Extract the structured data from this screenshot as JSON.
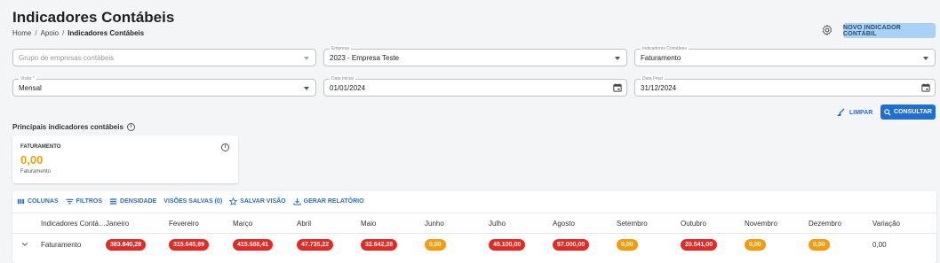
{
  "page": {
    "title": "Indicadores Contábeis",
    "breadcrumb": [
      "Home",
      "Apoio",
      "Indicadores Contábeis"
    ],
    "breadcrumb_sep": "/",
    "new_button": "NOVO INDICADOR CONTÁBIL"
  },
  "filters": {
    "grupo": {
      "placeholder": "Grupo de empresas contábeis"
    },
    "empresa": {
      "legend": "Empresa",
      "value": "2023 - Empresa Teste"
    },
    "indicadores": {
      "legend": "Indicadores Contábeis",
      "value": "Faturamento"
    },
    "visao": {
      "legend": "Visão *",
      "value": "Mensal"
    },
    "data_inicial": {
      "legend": "Data Inicial",
      "value": "01/01/2024"
    },
    "data_final": {
      "legend": "Data Final",
      "value": "31/12/2024"
    },
    "clear_button": "LIMPAR",
    "search_button": "CONSULTAR"
  },
  "summary": {
    "section_title": "Principais indicadores contábeis",
    "card": {
      "label": "FATURAMENTO",
      "value": "0,00",
      "sublabel": "Faturamento"
    }
  },
  "grid": {
    "toolbar": [
      "COLUNAS",
      "FILTROS",
      "DENSIDADE",
      "VISÕES SALVAS (0)",
      "SALVAR VISÃO",
      "GERAR RELATÓRIO"
    ],
    "columns": [
      "Indicadores Contá…",
      "Janeiro",
      "Fevereiro",
      "Março",
      "Abril",
      "Maio",
      "Junho",
      "Julho",
      "Agosto",
      "Setembro",
      "Outubro",
      "Novembro",
      "Dezembro",
      "Variação"
    ],
    "rows": [
      {
        "name": "Faturamento",
        "months": [
          {
            "value": "383.840,28",
            "status": "negative"
          },
          {
            "value": "315.645,89",
            "status": "negative"
          },
          {
            "value": "415.688,41",
            "status": "negative"
          },
          {
            "value": "47.735,22",
            "status": "negative"
          },
          {
            "value": "32.642,28",
            "status": "negative"
          },
          {
            "value": "0,00",
            "status": "zero"
          },
          {
            "value": "45.100,00",
            "status": "negative"
          },
          {
            "value": "57.000,00",
            "status": "negative"
          },
          {
            "value": "0,00",
            "status": "zero"
          },
          {
            "value": "20.541,00",
            "status": "negative"
          },
          {
            "value": "0,00",
            "status": "zero"
          },
          {
            "value": "0,00",
            "status": "zero"
          }
        ],
        "variation": "0,00"
      }
    ]
  },
  "colors": {
    "negative": "#e02b27",
    "zero": "#f39c12",
    "primary": "#1f6fd0",
    "link": "#2b6ec0"
  }
}
